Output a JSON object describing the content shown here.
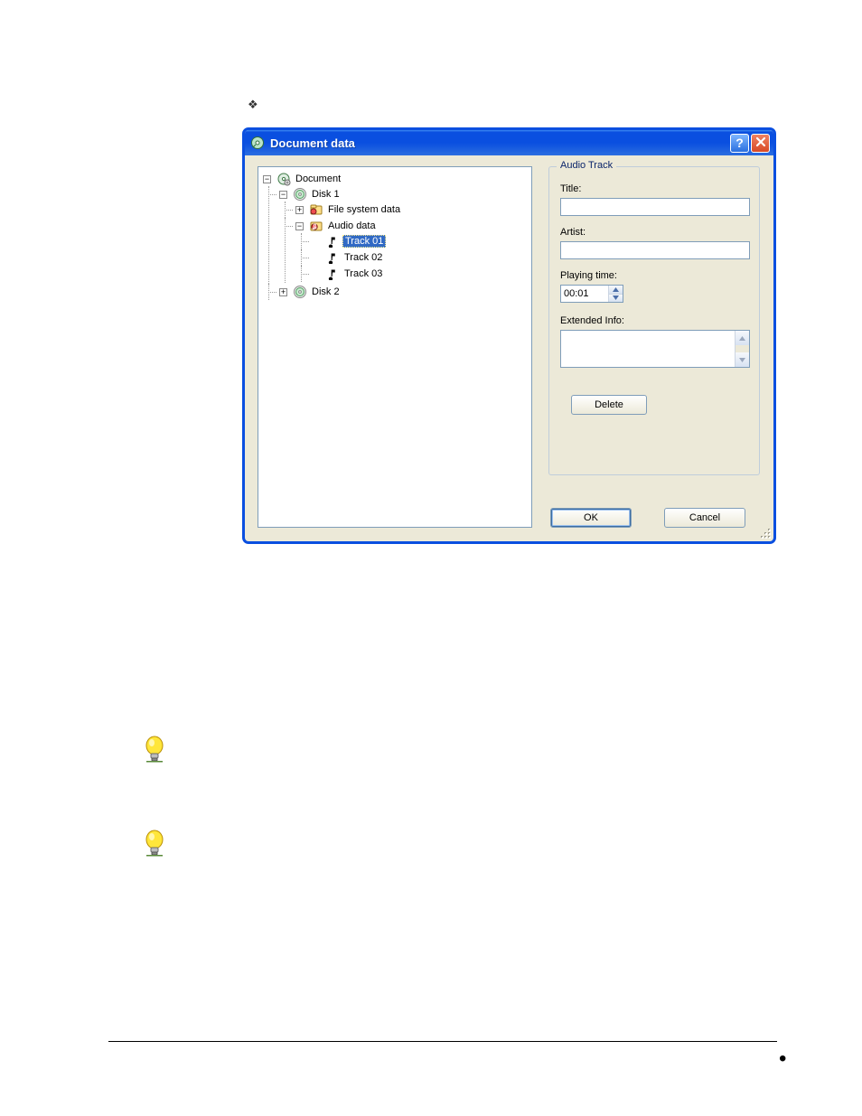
{
  "dialog": {
    "title": "Document data",
    "help_tooltip": "?",
    "close_tooltip": "×"
  },
  "tree": {
    "root": "Document",
    "disk1": "Disk 1",
    "file_system_data": "File system data",
    "audio_data": "Audio data",
    "track01": "Track 01",
    "track02": "Track 02",
    "track03": "Track 03",
    "disk2": "Disk 2"
  },
  "groupbox": {
    "legend": "Audio Track",
    "title_label": "Title:",
    "title_value": "",
    "artist_label": "Artist:",
    "artist_value": "",
    "playing_time_label": "Playing time:",
    "playing_time_value": "00:01",
    "extended_label": "Extended Info:",
    "extended_value": "",
    "delete_label": "Delete"
  },
  "buttons": {
    "ok": "OK",
    "cancel": "Cancel"
  }
}
